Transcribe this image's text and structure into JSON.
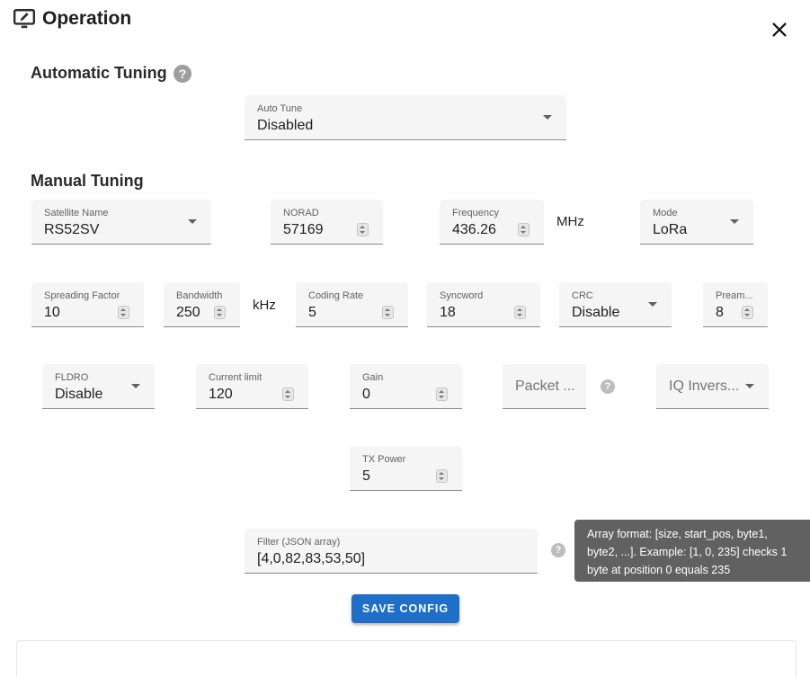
{
  "header": {
    "title": "Operation",
    "icon": "monitor-edit-icon",
    "close_icon": "close-icon"
  },
  "auto_tuning": {
    "heading": "Automatic Tuning",
    "auto_tune": {
      "label": "Auto Tune",
      "value": "Disabled"
    }
  },
  "manual_tuning": {
    "heading": "Manual Tuning",
    "satellite_name": {
      "label": "Satellite Name",
      "value": "RS52SV"
    },
    "norad": {
      "label": "NORAD",
      "value": "57169"
    },
    "frequency": {
      "label": "Frequency",
      "value": "436.26",
      "unit": "MHz"
    },
    "mode": {
      "label": "Mode",
      "value": "LoRa"
    },
    "spreading_factor": {
      "label": "Spreading Factor",
      "value": "10"
    },
    "bandwidth": {
      "label": "Bandwidth",
      "value": "250",
      "unit": "kHz"
    },
    "coding_rate": {
      "label": "Coding Rate",
      "value": "5"
    },
    "syncword": {
      "label": "Syncword",
      "value": "18"
    },
    "crc": {
      "label": "CRC",
      "value": "Disable"
    },
    "preamble": {
      "label": "Pream...",
      "value": "8"
    },
    "fldro": {
      "label": "FLDRO",
      "value": "Disable"
    },
    "current_limit": {
      "label": "Current limit",
      "value": "120"
    },
    "gain": {
      "label": "Gain",
      "value": "0"
    },
    "packet": {
      "placeholder": "Packet ..."
    },
    "iq_inversion": {
      "placeholder": "IQ Invers..."
    },
    "tx_power": {
      "label": "TX Power",
      "value": "5"
    },
    "filter": {
      "label": "Filter (JSON array)",
      "value": "[4,0,82,83,53,50]"
    }
  },
  "tooltip": {
    "text": "Array format: [size, start_pos, byte1, byte2, ...]. Example: [1, 0, 235] checks 1 byte at position 0 equals 235"
  },
  "actions": {
    "save_label": "SAVE CONFIG"
  },
  "colors": {
    "primary": "#1f6fc9",
    "tooltip_bg": "#616161",
    "field_bg": "#f5f5f5"
  }
}
